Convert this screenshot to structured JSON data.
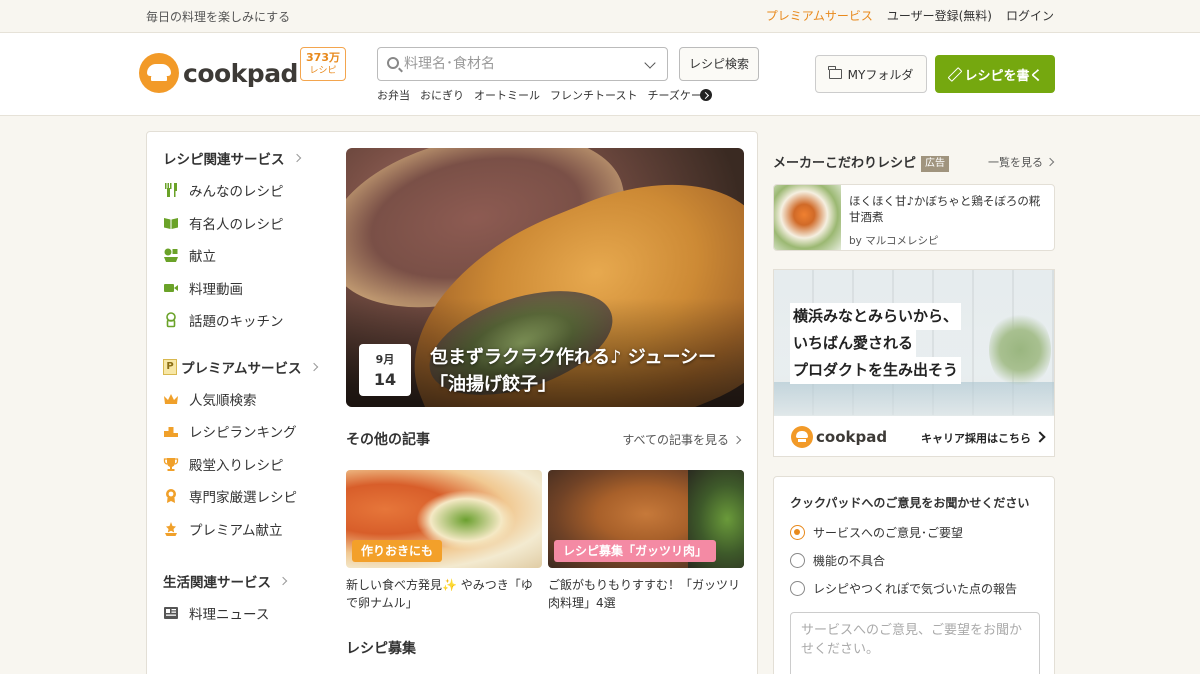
{
  "topbar": {
    "tagline": "毎日の料理を楽しみにする",
    "premium": "プレミアムサービス",
    "register": "ユーザー登録(無料)",
    "login": "ログイン"
  },
  "header": {
    "logo_text": "cookpad",
    "recipe_count": "373万",
    "recipe_count_label": "レシピ",
    "search_placeholder": "料理名･食材名",
    "search_button": "レシピ検索",
    "suggestions": [
      "お弁当",
      "おにぎり",
      "オートミール",
      "フレンチトースト",
      "チーズケーキ"
    ],
    "myfolder": "MYフォルダ",
    "write_recipe": "レシピを書く"
  },
  "nav": {
    "recipe_head": "レシピ関連サービス",
    "recipe_items": [
      {
        "label": "みんなのレシピ",
        "icon": "fork-knife-icon"
      },
      {
        "label": "有名人のレシピ",
        "icon": "book-icon"
      },
      {
        "label": "献立",
        "icon": "meal-set-icon"
      },
      {
        "label": "料理動画",
        "icon": "video-camera-icon"
      },
      {
        "label": "話題のキッチン",
        "icon": "chef-hat-icon"
      }
    ],
    "premium_head": "プレミアムサービス",
    "premium_badge": "P",
    "premium_items": [
      {
        "label": "人気順検索",
        "icon": "crown-icon"
      },
      {
        "label": "レシピランキング",
        "icon": "ranking-icon"
      },
      {
        "label": "殿堂入りレシピ",
        "icon": "trophy-icon"
      },
      {
        "label": "専門家厳選レシピ",
        "icon": "expert-icon"
      },
      {
        "label": "プレミアム献立",
        "icon": "premium-meal-icon"
      }
    ],
    "life_head": "生活関連サービス",
    "life_items": [
      {
        "label": "料理ニュース",
        "icon": "newspaper-icon"
      }
    ]
  },
  "feature": {
    "month": "9月",
    "day": "14",
    "title_line1": "包まずラクラク作れる♪ ジューシー",
    "title_line2": "「油揚げ餃子」"
  },
  "articles": {
    "head": "その他の記事",
    "all_link": "すべての記事を見る",
    "items": [
      {
        "tag": "作りおきにも",
        "caption": "新しい食べ方発見✨ やみつき「ゆで卵ナムル」"
      },
      {
        "tag": "レシピ募集「ガッツリ肉」",
        "caption": "ご飯がもりもりすすむ！「ガッツリ肉料理」4選"
      }
    ]
  },
  "recipe_recruit_head": "レシピ募集",
  "ads": {
    "head": "メーカーこだわりレシピ",
    "ad_label": "広告",
    "more": "一覧を見る",
    "card": {
      "title": "ほくほく甘♪かぼちゃと鶏そぼろの糀甘酒煮",
      "by": "by マルコメレシピ"
    }
  },
  "banner": {
    "line1": "横浜みなとみらいから、",
    "line2": "いちばん愛される",
    "line3": "プロダクトを生み出そう",
    "logo_text": "cookpad",
    "careers": "キャリア採用はこちら"
  },
  "feedback": {
    "question": "クックパッドへのご意見をお聞かせください",
    "options": [
      {
        "label": "サービスへのご意見･ご要望",
        "checked": true
      },
      {
        "label": "機能の不具合",
        "checked": false
      },
      {
        "label": "レシピやつくれぽで気づいた点の報告",
        "checked": false
      }
    ],
    "placeholder": "サービスへのご意見、ご要望をお聞かせください。"
  },
  "colors": {
    "accent_orange": "#e8891c",
    "brand_green": "#75a80f",
    "page_background": "#f8f6f0"
  }
}
